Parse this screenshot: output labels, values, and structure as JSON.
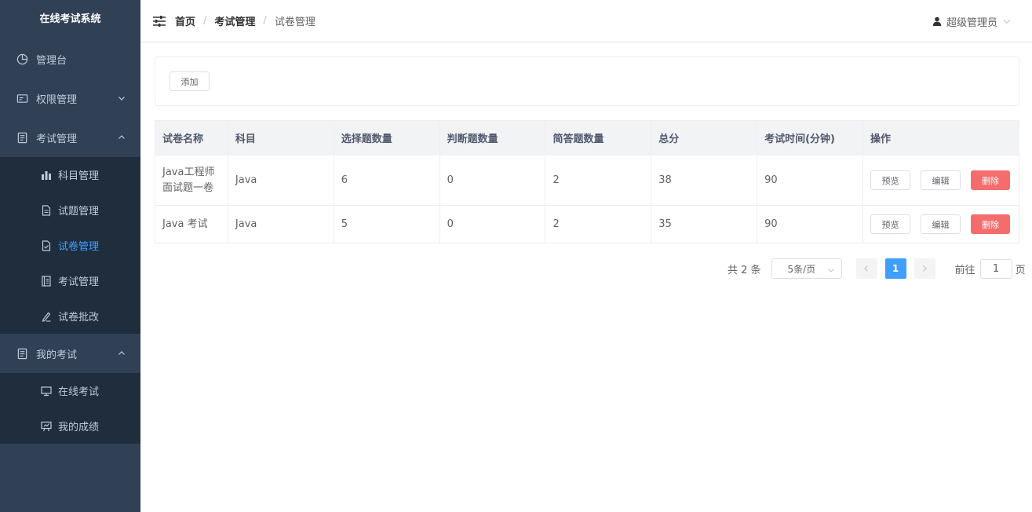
{
  "app_title": "在线考试系统",
  "sidebar": {
    "items": [
      {
        "label": "管理台",
        "icon": "dashboard-icon"
      },
      {
        "label": "权限管理",
        "icon": "permission-icon"
      },
      {
        "label": "考试管理",
        "icon": "exam-manage-icon",
        "children": [
          {
            "label": "科目管理",
            "icon": "bar-chart-icon"
          },
          {
            "label": "试题管理",
            "icon": "document-icon"
          },
          {
            "label": "试卷管理",
            "icon": "paper-check-icon",
            "active": true
          },
          {
            "label": "考试管理",
            "icon": "notebook-icon"
          },
          {
            "label": "试卷批改",
            "icon": "pencil-icon"
          }
        ]
      },
      {
        "label": "我的考试",
        "icon": "my-exam-icon",
        "children": [
          {
            "label": "在线考试",
            "icon": "monitor-icon"
          },
          {
            "label": "我的成绩",
            "icon": "score-board-icon"
          }
        ]
      }
    ]
  },
  "header": {
    "breadcrumb": [
      "首页",
      "考试管理",
      "试卷管理"
    ],
    "user": "超级管理员"
  },
  "toolbar": {
    "add_label": "添加"
  },
  "table": {
    "columns": [
      "试卷名称",
      "科目",
      "选择题数量",
      "判断题数量",
      "简答题数量",
      "总分",
      "考试时间(分钟)",
      "操作"
    ],
    "rows": [
      {
        "name_line1": "Java工程师",
        "name_line2": "面试题一卷",
        "subject": "Java",
        "choice": "6",
        "judge": "0",
        "short": "2",
        "total": "38",
        "time": "90"
      },
      {
        "name_line1": "Java 考试",
        "name_line2": "",
        "subject": "Java",
        "choice": "5",
        "judge": "0",
        "short": "2",
        "total": "35",
        "time": "90"
      }
    ],
    "actions": {
      "preview": "预览",
      "edit": "编辑",
      "delete": "删除"
    }
  },
  "pagination": {
    "total": "共 2 条",
    "page_size": "5条/页",
    "current_page": "1",
    "goto_prefix": "前往",
    "goto_value": "1",
    "goto_suffix": "页"
  },
  "colors": {
    "sidebar_bg": "#304156",
    "submenu_bg": "#1f2d3d",
    "accent": "#409eff",
    "danger": "#f56c6c"
  }
}
